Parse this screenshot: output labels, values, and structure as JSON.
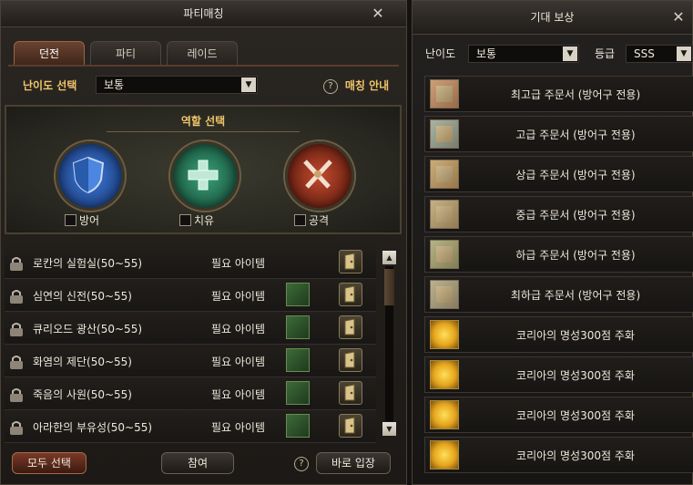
{
  "party": {
    "title": "파티매칭",
    "tabs": [
      "던전",
      "파티",
      "레이드"
    ],
    "difficulty_label": "난이도 선택",
    "difficulty_value": "보통",
    "guide_label": "매칭 안내",
    "role_title": "역할 선택",
    "roles": [
      {
        "label": "방어",
        "icon": "shield-icon",
        "color": "#2d5fb8"
      },
      {
        "label": "치유",
        "icon": "cross-icon",
        "color": "#2f8a5a"
      },
      {
        "label": "공격",
        "icon": "swords-icon",
        "color": "#a3301f"
      }
    ],
    "dungeons": [
      {
        "name": "로칸의 실험실(50~55)",
        "req": "필요 아이템",
        "has_item": false
      },
      {
        "name": "심연의 신전(50~55)",
        "req": "필요 아이템",
        "has_item": true
      },
      {
        "name": "큐리오드 광산(50~55)",
        "req": "필요 아이템",
        "has_item": true
      },
      {
        "name": "화염의 제단(50~55)",
        "req": "필요 아이템",
        "has_item": true
      },
      {
        "name": "죽음의 사원(50~55)",
        "req": "필요 아이템",
        "has_item": true
      },
      {
        "name": "아라한의 부유성(50~55)",
        "req": "필요 아이템",
        "has_item": true
      }
    ],
    "buttons": {
      "select_all": "모두 선택",
      "join": "참여",
      "enter_now": "바로 입장"
    }
  },
  "reward": {
    "title": "기대 보상",
    "difficulty_label": "난이도",
    "difficulty_value": "보통",
    "grade_label": "등급",
    "grade_value": "SSS",
    "items": [
      {
        "name": "최고급 주문서 (방어구 전용)",
        "icon": "scroll-icon",
        "tint": "#b5533a"
      },
      {
        "name": "고급 주문서 (방어구 전용)",
        "icon": "scroll-icon",
        "tint": "#4f8fb0"
      },
      {
        "name": "상급 주문서 (방어구 전용)",
        "icon": "scroll-icon",
        "tint": "#b07a3a"
      },
      {
        "name": "중급 주문서 (방어구 전용)",
        "icon": "scroll-icon",
        "tint": "#a0885a"
      },
      {
        "name": "하급 주문서 (방어구 전용)",
        "icon": "scroll-icon",
        "tint": "#6d8f5d"
      },
      {
        "name": "최하급 주문서 (방어구 전용)",
        "icon": "scroll-icon",
        "tint": "#7d8a80"
      },
      {
        "name": "코리아의 명성300점 주화",
        "icon": "coin-icon",
        "tint": "#e5a51d"
      },
      {
        "name": "코리아의 명성300점 주화",
        "icon": "coin-icon",
        "tint": "#e5a51d"
      },
      {
        "name": "코리아의 명성300점 주화",
        "icon": "coin-icon",
        "tint": "#e5a51d"
      },
      {
        "name": "코리아의 명성300점 주화",
        "icon": "coin-icon",
        "tint": "#e5a51d"
      }
    ]
  }
}
